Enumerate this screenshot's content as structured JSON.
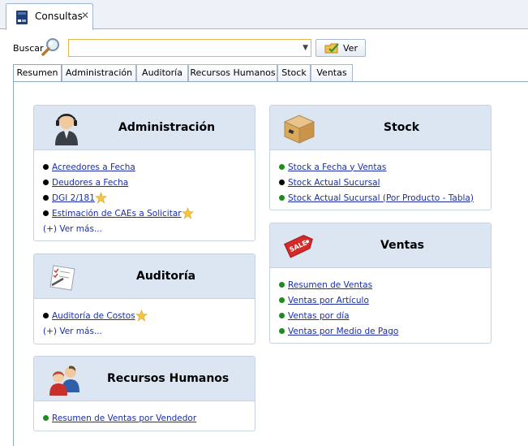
{
  "document_tab": {
    "title": "Consultas",
    "close": "✕"
  },
  "search": {
    "label": "Buscar",
    "value": "",
    "button_label": "Ver"
  },
  "tabs": [
    {
      "label": "Resumen",
      "active": true
    },
    {
      "label": "Administración",
      "active": false
    },
    {
      "label": "Auditoría",
      "active": false
    },
    {
      "label": "Recursos Humanos",
      "active": false
    },
    {
      "label": "Stock",
      "active": false
    },
    {
      "label": "Ventas",
      "active": false
    }
  ],
  "colors": {
    "bullet_black": "#000000",
    "bullet_green": "#1f8a1f",
    "link": "#1a2ea8",
    "panel_header": "#dce6f2",
    "star": "#f5c542"
  },
  "panels": {
    "administracion": {
      "title": "Administración",
      "icon": "user-headset-icon",
      "items": [
        {
          "label": "Acreedores a Fecha",
          "bullet": "black",
          "starred": false
        },
        {
          "label": "Deudores a Fecha",
          "bullet": "black",
          "starred": false
        },
        {
          "label": "DGI 2/181",
          "bullet": "black",
          "starred": true
        },
        {
          "label": "Estimación de CAEs a Solicitar",
          "bullet": "black",
          "starred": true
        }
      ],
      "more": "(+) Ver más..."
    },
    "auditoria": {
      "title": "Auditoría",
      "icon": "checklist-pen-icon",
      "items": [
        {
          "label": "Auditoría de Costos",
          "bullet": "black",
          "starred": true
        }
      ],
      "more": "(+) Ver más..."
    },
    "recursos_humanos": {
      "title": "Recursos Humanos",
      "icon": "people-icon",
      "items": [
        {
          "label": "Resumen de Ventas por Vendedor",
          "bullet": "green",
          "starred": false
        }
      ]
    },
    "stock": {
      "title": "Stock",
      "icon": "box-icon",
      "items": [
        {
          "label": "Stock a Fecha y Ventas",
          "bullet": "green",
          "starred": false
        },
        {
          "label": "Stock Actual Sucursal",
          "bullet": "black",
          "starred": false
        },
        {
          "label": "Stock Actual Sucursal (Por Producto - Tabla)",
          "bullet": "green",
          "starred": false
        }
      ]
    },
    "ventas": {
      "title": "Ventas",
      "icon": "sale-tag-icon",
      "items": [
        {
          "label": "Resumen de Ventas",
          "bullet": "green",
          "starred": false
        },
        {
          "label": "Ventas por Artículo",
          "bullet": "green",
          "starred": false
        },
        {
          "label": "Ventas por día",
          "bullet": "green",
          "starred": false
        },
        {
          "label": "Ventas por Medio de Pago",
          "bullet": "green",
          "starred": false
        }
      ]
    }
  }
}
